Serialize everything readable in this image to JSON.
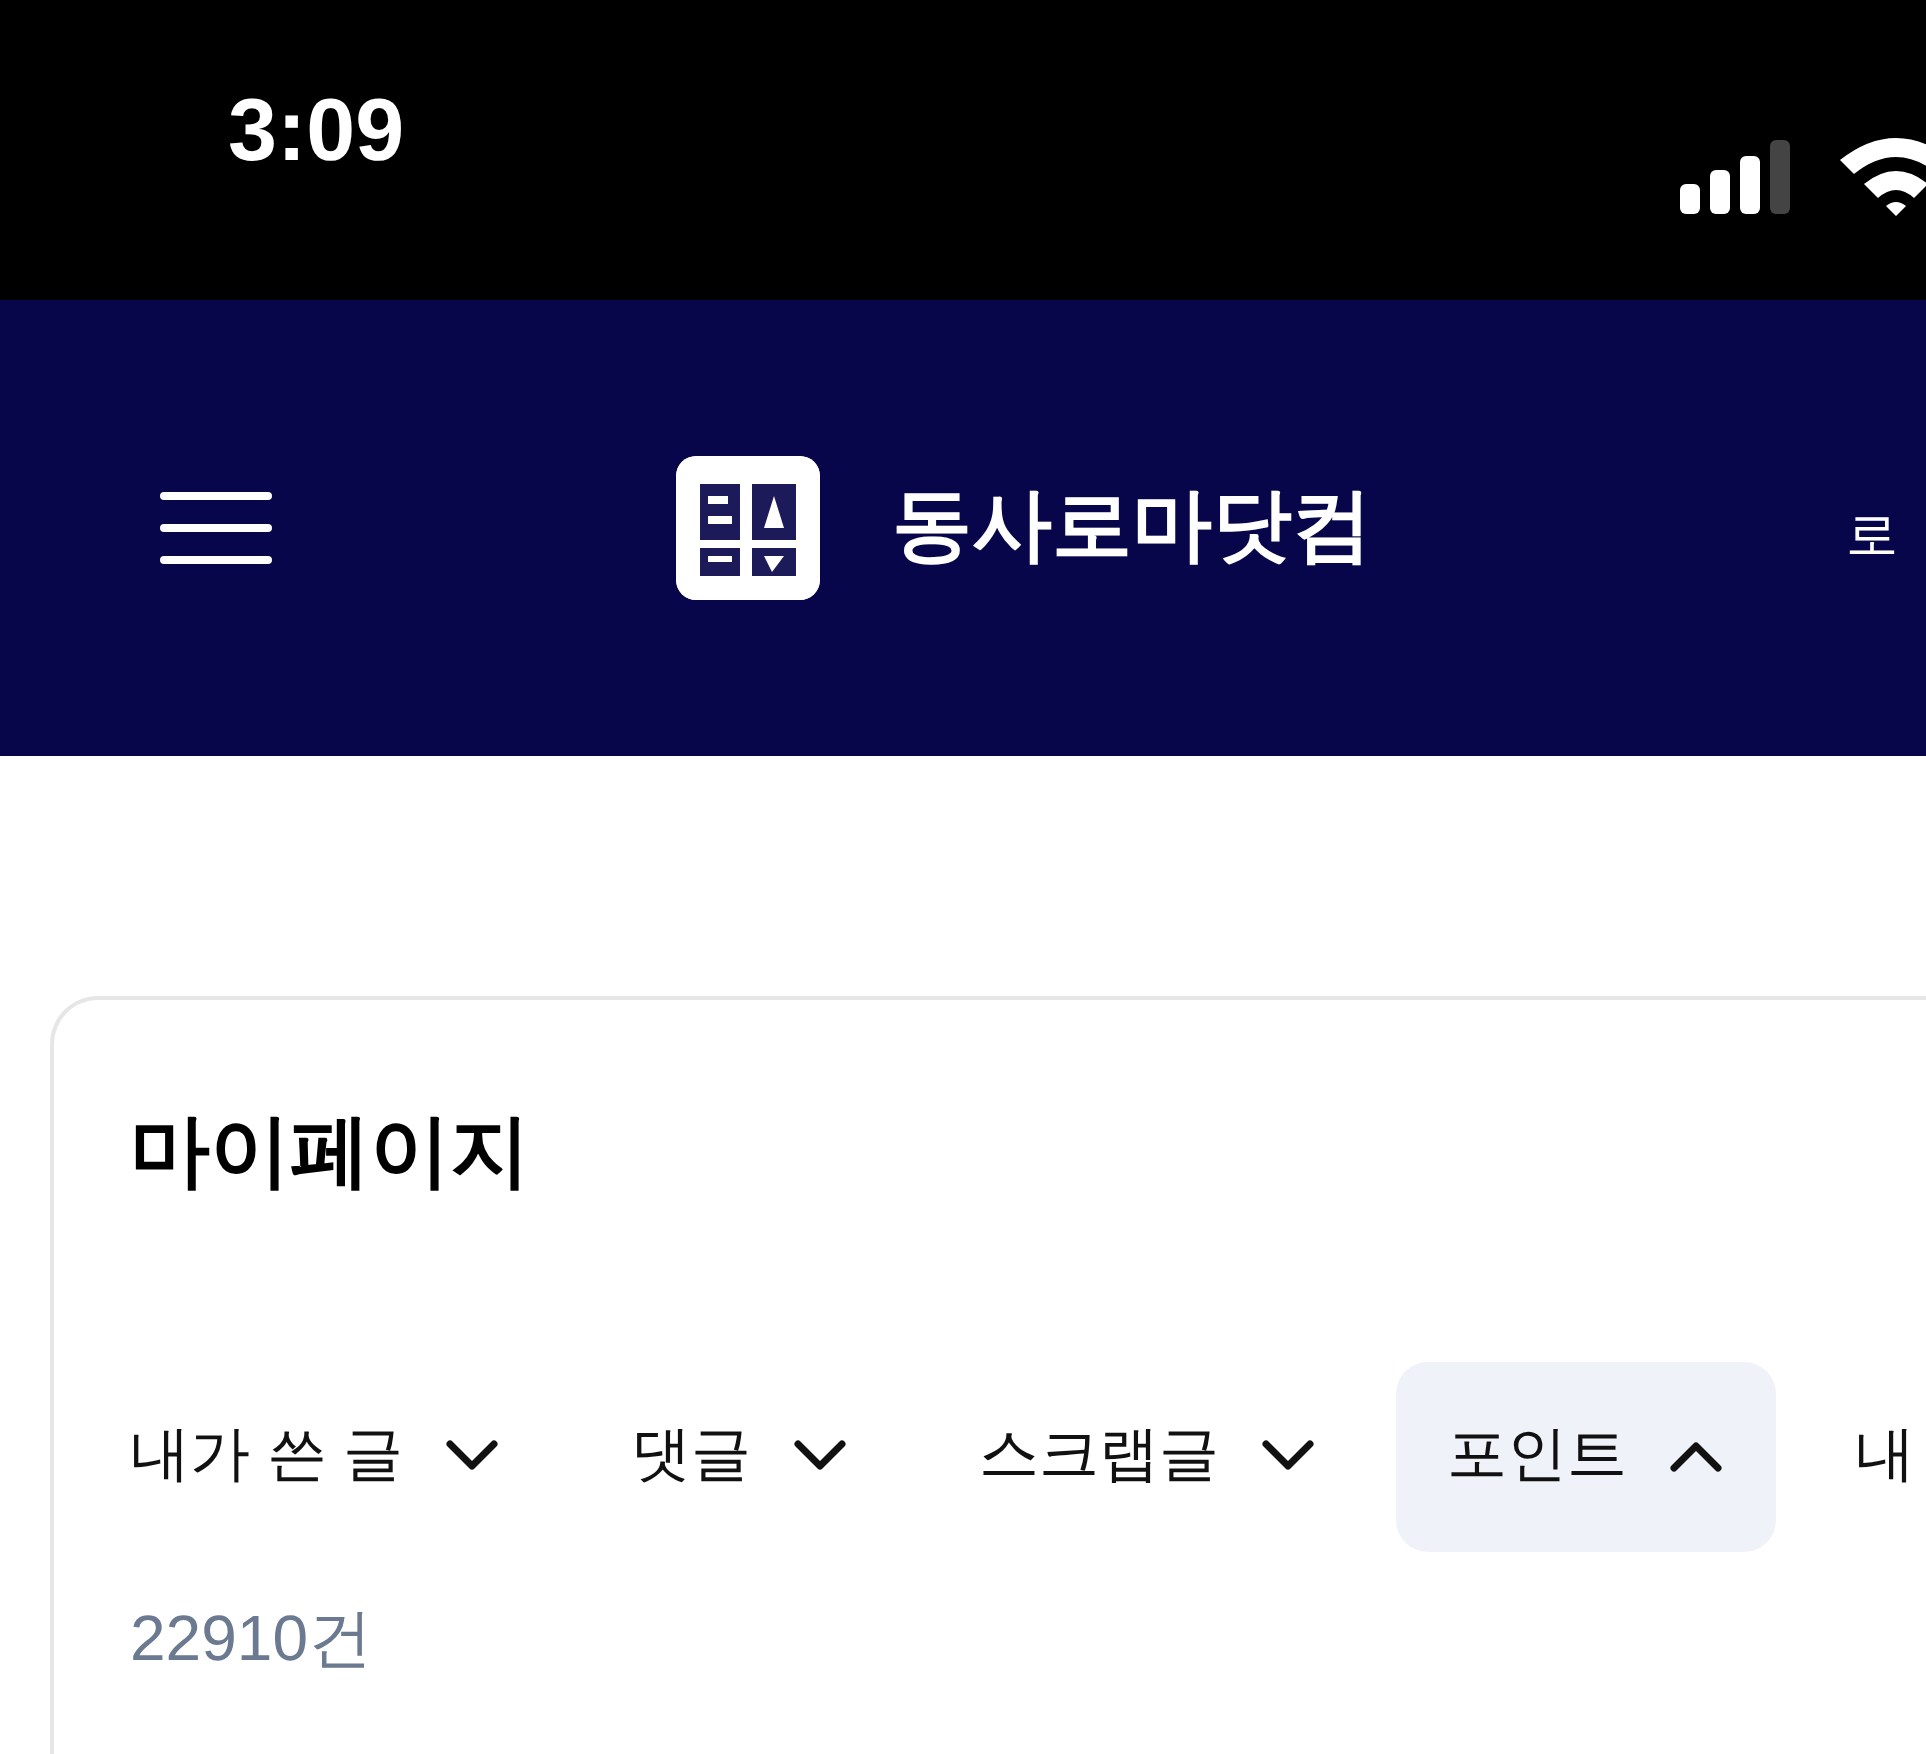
{
  "status_bar": {
    "time": "3:09"
  },
  "header": {
    "title": "동사로마닷컴",
    "login": "로"
  },
  "page": {
    "title": "마이페이지",
    "tabs": [
      {
        "label": "내가 쓴 글",
        "selected": false,
        "caret": true
      },
      {
        "label": "댓글",
        "selected": false,
        "caret": true
      },
      {
        "label": "스크랩글",
        "selected": false,
        "caret": true
      },
      {
        "label": "포인트",
        "selected": true,
        "caret": true
      },
      {
        "label": "내",
        "selected": false,
        "caret": false
      }
    ],
    "count": "22910건"
  }
}
